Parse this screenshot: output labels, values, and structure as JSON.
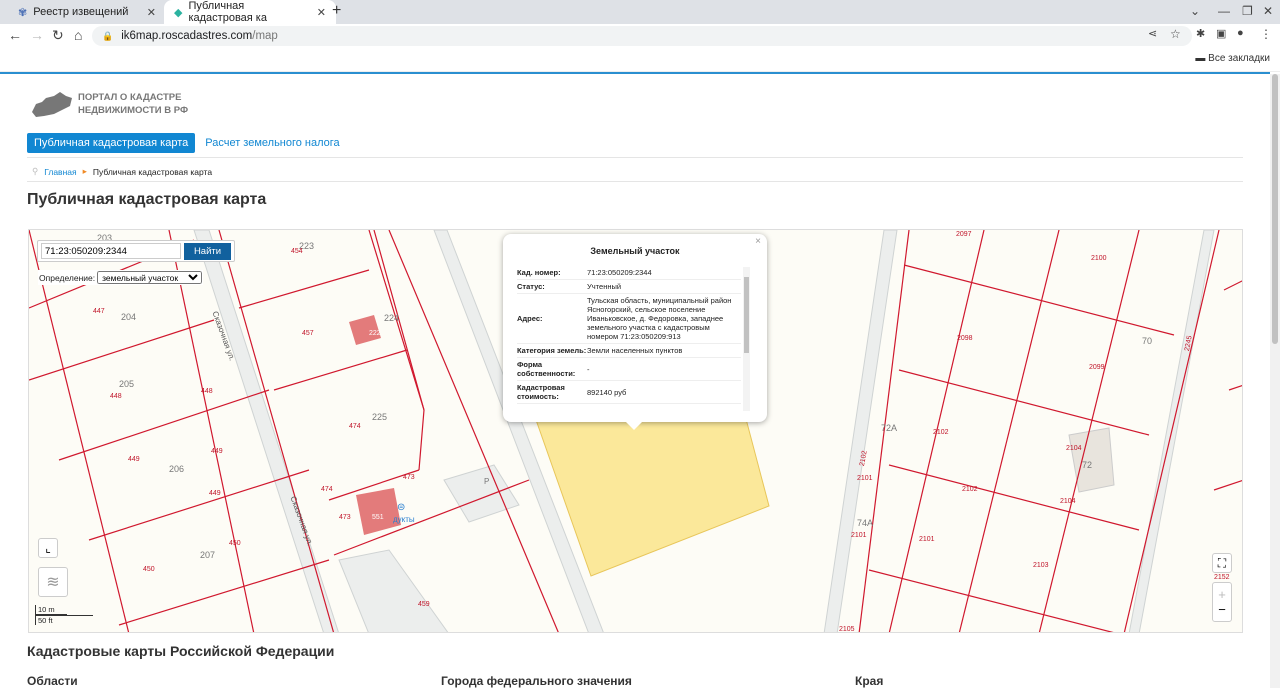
{
  "browser": {
    "tabs": [
      {
        "title": "Реестр извещений"
      },
      {
        "title": "Публичная кадастровая ка"
      }
    ],
    "url_host": "ik6map.roscadastres.com",
    "url_path": "/map",
    "bookmarks_label": "Все закладки"
  },
  "site": {
    "logo_line1": "ПОРТАЛ О КАДАСТРЕ",
    "logo_line2": "НЕДВИЖИМОСТИ В РФ",
    "menu": [
      {
        "label": "Публичная кадастровая карта",
        "active": true
      },
      {
        "label": "Расчет земельного налога",
        "active": false
      }
    ],
    "breadcrumb": {
      "home": "Главная",
      "current": "Публичная кадастровая карта"
    },
    "page_title": "Публичная кадастровая карта"
  },
  "map": {
    "search_value": "71:23:050209:2344",
    "search_button": "Найти",
    "definition_label": "Определение:",
    "definition_value": "земельный участок",
    "street": "Сказочная ул.",
    "scale_m": "10 m",
    "scale_ft": "50 ft",
    "poi": "дукты",
    "parking": "P",
    "parcel_labels": [
      "203",
      "223",
      "454",
      "447",
      "204",
      "457",
      "224",
      "222",
      "205",
      "448",
      "448",
      "225",
      "474",
      "449",
      "206",
      "449",
      "449",
      "473",
      "474",
      "473",
      "551",
      "450",
      "207",
      "450",
      "459",
      "2097",
      "2100",
      "2098",
      "70",
      "2099",
      "2245",
      "72A",
      "2102",
      "2104",
      "72",
      "2102",
      "2101",
      "2102",
      "2104",
      "74A",
      "2101",
      "2101",
      "2103",
      "2152",
      "2105"
    ],
    "zoom_in": "+",
    "zoom_out": "−"
  },
  "popup": {
    "title": "Земельный участок",
    "rows": [
      {
        "key": "Кад. номер:",
        "value": "71:23:050209:2344"
      },
      {
        "key": "Статус:",
        "value": "Учтенный"
      },
      {
        "key": "Адрес:",
        "value": "Тульская область, муниципальный район Ясногорский, сельское поселение Иваньковское, д. Федоровка, западнее земельного участка с кадастровым номером 71:23:050209:913"
      },
      {
        "key": "Категория земель:",
        "value": "Земли населенных пунктов"
      },
      {
        "key": "Форма собственности:",
        "value": "-"
      },
      {
        "key": "Кадастровая стоимость:",
        "value": "892140 руб"
      }
    ]
  },
  "footer": {
    "heading": "Кадастровые карты Российской Федерации",
    "columns": [
      "Области",
      "Города федерального значения",
      "Края"
    ]
  },
  "colors": {
    "accent": "#1187d2",
    "parcel_line": "#d0182e",
    "selected_parcel": "#fbe89a"
  }
}
